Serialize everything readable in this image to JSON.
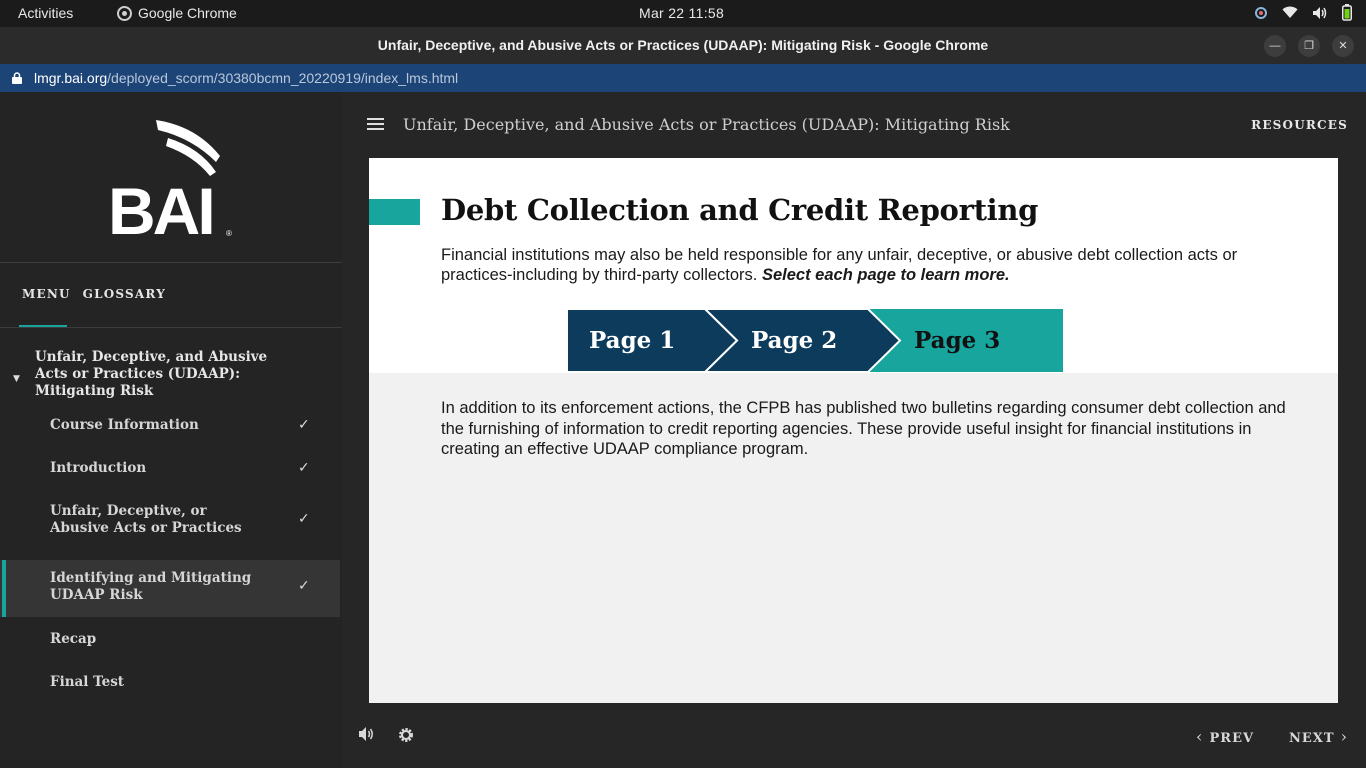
{
  "system": {
    "activities": "Activities",
    "app_name": "Google Chrome",
    "clock": "Mar 22  11:58"
  },
  "window": {
    "title": "Unfair, Deceptive, and Abusive Acts or Practices (UDAAP): Mitigating Risk - Google Chrome",
    "url_host": "lmgr.bai.org",
    "url_path": "/deployed_scorm/30380bcmn_20220919/index_lms.html"
  },
  "sidebar": {
    "logo_text": "BAI",
    "tabs": [
      "MENU",
      "GLOSSARY"
    ],
    "course_title": "Unfair, Deceptive, and Abusive Acts or Practices (UDAAP): Mitigating Risk",
    "items": [
      {
        "label": "Course Information",
        "completed": true
      },
      {
        "label": "Introduction",
        "completed": true
      },
      {
        "label": "Unfair, Deceptive, or Abusive Acts or Practices",
        "completed": true
      },
      {
        "label": "Identifying and Mitigating UDAAP Risk",
        "completed": true,
        "active": true
      },
      {
        "label": "Recap",
        "completed": false
      },
      {
        "label": "Final Test",
        "completed": false
      }
    ],
    "check_glyph": "✓"
  },
  "header": {
    "course_heading": "Unfair, Deceptive, and Abusive Acts or Practices (UDAAP): Mitigating Risk",
    "resources": "RESOURCES"
  },
  "content": {
    "heading": "Debt Collection and Credit Reporting",
    "intro": "Financial institutions may also be held responsible for any unfair, deceptive, or abusive debt collection acts or practices-including by third-party collectors.",
    "intro_emphasis": "Select each page to learn more.",
    "tabs": [
      {
        "label": "Page 1",
        "selected": false
      },
      {
        "label": "Page 2",
        "selected": false
      },
      {
        "label": "Page 3",
        "selected": true
      }
    ],
    "body": "In addition to its enforcement actions, the CFPB has published two bulletins regarding consumer debt collection and the furnishing of information to credit reporting agencies. These provide useful insight for financial institutions in creating an effective UDAAP compliance program."
  },
  "footer": {
    "prev": "PREV",
    "next": "NEXT"
  },
  "colors": {
    "accent": "#17a59d",
    "tab_dark": "#0d3b5c",
    "url_bar": "#1d4477"
  }
}
